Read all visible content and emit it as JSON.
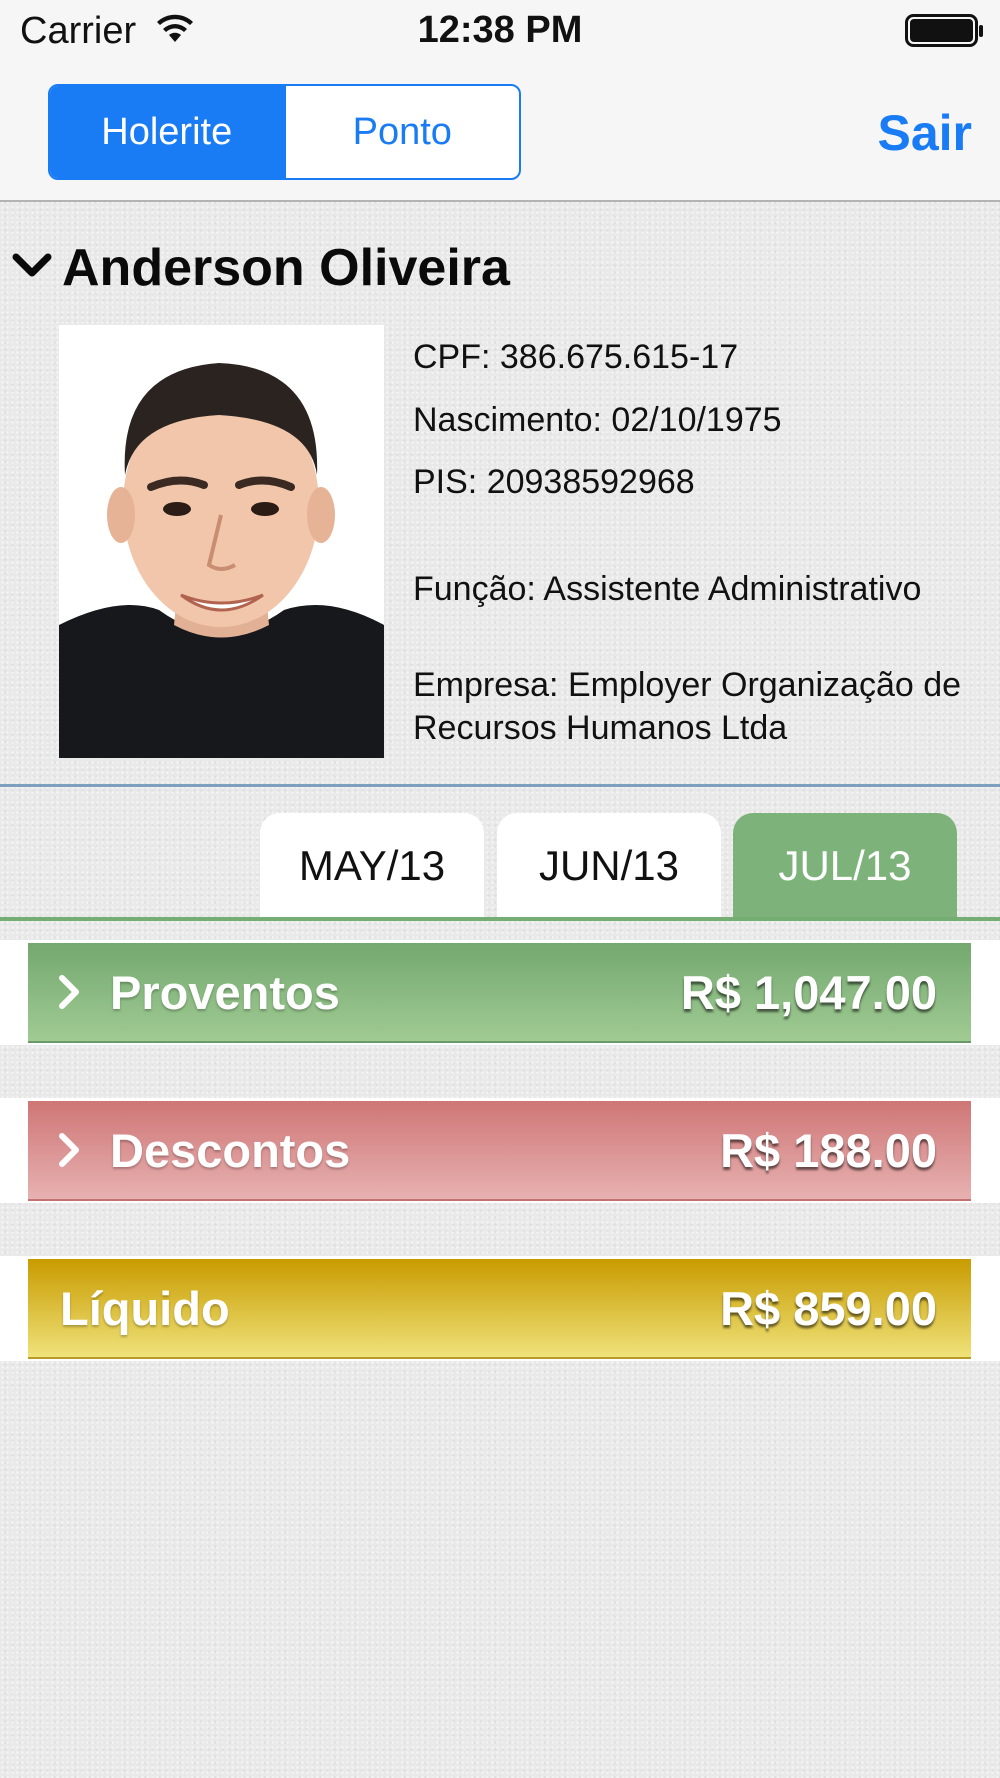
{
  "status_bar": {
    "carrier": "Carrier",
    "time": "12:38 PM"
  },
  "nav": {
    "segments": [
      {
        "label": "Holerite",
        "selected": true
      },
      {
        "label": "Ponto",
        "selected": false
      }
    ],
    "logout_label": "Sair"
  },
  "employee": {
    "name": "Anderson Oliveira",
    "cpf": "CPF: 386.675.615-17",
    "nascimento": "Nascimento: 02/10/1975",
    "pis": "PIS: 20938592968",
    "funcao": "Função: Assistente Administrativo",
    "empresa": "Empresa: Employer Organização de Recursos Humanos Ltda"
  },
  "months": [
    {
      "label": "MAY/13",
      "selected": false
    },
    {
      "label": "JUN/13",
      "selected": false
    },
    {
      "label": "JUL/13",
      "selected": true
    }
  ],
  "summary": {
    "proventos": {
      "label": "Proventos",
      "amount": "R$ 1,047.00"
    },
    "descontos": {
      "label": "Descontos",
      "amount": "R$ 188.00"
    },
    "liquido": {
      "label": "Líquido",
      "amount": "R$ 859.00"
    }
  },
  "colors": {
    "accent": "#1a7cf5",
    "proventos": "#7db37b",
    "descontos": "#d98a8a",
    "liquido": "#d4b21a",
    "active_tab": "#7db37b"
  },
  "icons": [
    "wifi-icon",
    "battery-icon",
    "chevron-down-icon",
    "chevron-right-icon"
  ]
}
